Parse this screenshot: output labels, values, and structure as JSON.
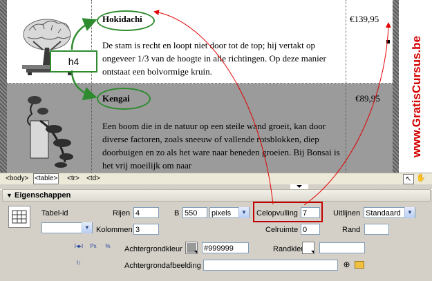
{
  "products": [
    {
      "name": "Hokidachi",
      "description": "De stam is recht en loopt niet door tot de top; hij vertakt op ongeveer 1/3 van de hoogte in alle richtingen. Op deze manier ontstaat een bolvormige kruin.",
      "price": "€139,95"
    },
    {
      "name": "Kengai",
      "description": "Een boom die in de natuur op een steile wand groeit, kan door diverse factoren, zoals sneeuw of vallende rotsblokken, diep doorbuigen en zo als het ware naar beneden groeien. Bij Bonsai is het vrij moeilijk om naar",
      "price": "€89,95"
    }
  ],
  "annotation": {
    "label": "h4"
  },
  "watermark": "www.GratisCursus.be",
  "tag_selector": {
    "tags": [
      "<body>",
      "<table>",
      "<tr>",
      "<td>"
    ]
  },
  "properties": {
    "title": "Eigenschappen",
    "table_id_label": "Tabel-id",
    "table_id_value": "",
    "rows_label": "Rijen",
    "rows_value": "4",
    "cols_label": "Kolommen",
    "cols_value": "3",
    "width_label": "B",
    "width_value": "550",
    "width_unit": "pixels",
    "padding_label": "Celopvulling",
    "padding_value": "7",
    "spacing_label": "Celruimte",
    "spacing_value": "0",
    "align_label": "Uitlijnen",
    "align_value": "Standaard",
    "border_label": "Rand",
    "border_value": "",
    "bgcolor_label": "Achtergrondkleur",
    "bgcolor_value": "#999999",
    "bordercolor_label": "Randkleur",
    "bordercolor_value": "",
    "bgimage_label": "Achtergrondafbeelding",
    "bgimage_value": ""
  },
  "colors": {
    "accent_green": "#2e8b2e",
    "arrow_red": "#e00000",
    "watermark_red": "#d40000",
    "gray_row": "#999999"
  }
}
